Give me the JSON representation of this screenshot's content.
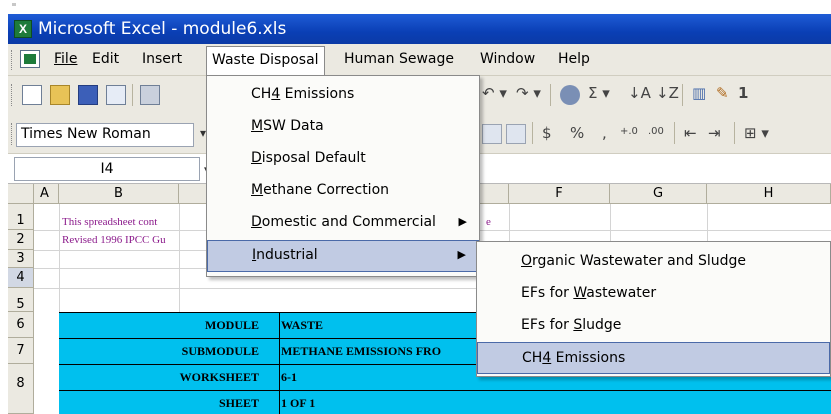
{
  "window": {
    "title": "Microsoft Excel - module6.xls",
    "app_icon": "X"
  },
  "menubar": {
    "items": [
      {
        "label": "File"
      },
      {
        "label": "Edit"
      },
      {
        "label": "Insert"
      },
      {
        "label": "Waste Disposal"
      },
      {
        "label": "Human Sewage"
      },
      {
        "label": "Window"
      },
      {
        "label": "Help"
      }
    ]
  },
  "toolbar": {
    "undo": "↶ ▾",
    "redo": "↷ ▾",
    "sigma": "Σ ▾",
    "sort_asc": "↓A",
    "sort_desc": "↓Z",
    "chart": "▥",
    "drawing": "✎",
    "zoom_digit": "1"
  },
  "format_toolbar": {
    "font": "Times New Roman",
    "currency": "$",
    "percent": "%",
    "comma": ",",
    "inc_decimal": "+.0",
    "dec_decimal": ".00",
    "indent_dec": "⇤",
    "indent_inc": "⇥",
    "borders": "⊞ ▾"
  },
  "formula_bar": {
    "name_box": "I4"
  },
  "grid": {
    "columns": [
      "A",
      "B",
      "F",
      "G",
      "H"
    ],
    "rows": [
      "1",
      "2",
      "3",
      "4",
      "5",
      "6",
      "7",
      "8"
    ],
    "notes": [
      "This spreadsheet cont",
      "Revised 1996 IPCC Gu"
    ],
    "note_tail": "e",
    "module_rows": [
      {
        "label": "MODULE",
        "value": "WASTE"
      },
      {
        "label": "SUBMODULE",
        "value": "METHANE EMISSIONS FRO"
      },
      {
        "label": "WORKSHEET",
        "value": "6-1"
      },
      {
        "label": "SHEET",
        "value": "1 OF 1"
      }
    ]
  },
  "waste_menu": {
    "items": [
      {
        "pre": "CH",
        "u": "4",
        "post": " Emissions"
      },
      {
        "pre": "",
        "u": "M",
        "post": "SW Data"
      },
      {
        "pre": "",
        "u": "D",
        "post": "isposal Default"
      },
      {
        "pre": "",
        "u": "M",
        "post": "ethane Correction"
      },
      {
        "pre": "",
        "u": "D",
        "post": "omestic and Commercial"
      },
      {
        "pre": "",
        "u": "I",
        "post": "ndustrial"
      }
    ],
    "arrow": "▶"
  },
  "industrial_submenu": {
    "items": [
      {
        "pre": "",
        "u": "O",
        "post": "rganic Wastewater and Sludge"
      },
      {
        "pre": "EFs for ",
        "u": "W",
        "post": "astewater"
      },
      {
        "pre": "EFs for ",
        "u": "S",
        "post": "ludge"
      },
      {
        "pre": "CH",
        "u": "4",
        "post": " Emissions"
      }
    ]
  }
}
